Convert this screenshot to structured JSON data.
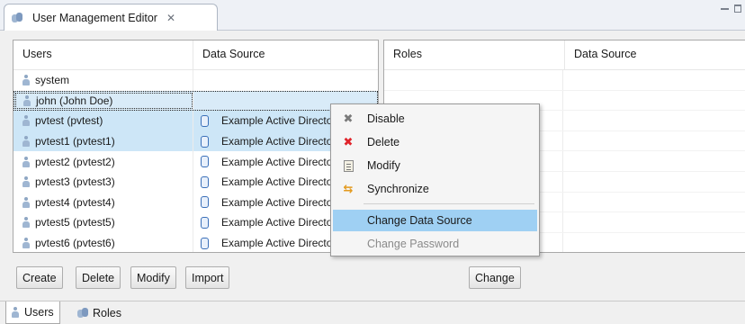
{
  "editor": {
    "tab_title": "User Management Editor",
    "close_glyph": "✕"
  },
  "users_table": {
    "headers": [
      "Users",
      "Data Source"
    ],
    "rows": [
      {
        "name": "system",
        "source": "",
        "selected": false,
        "focused": false
      },
      {
        "name": "john (John Doe)",
        "source": "",
        "selected": false,
        "focused": true
      },
      {
        "name": "pvtest (pvtest)",
        "source": "Example Active Directory",
        "selected": true,
        "focused": false
      },
      {
        "name": "pvtest1 (pvtest1)",
        "source": "Example Active Directory",
        "selected": true,
        "focused": false
      },
      {
        "name": "pvtest2 (pvtest2)",
        "source": "Example Active Directory",
        "selected": false,
        "focused": false
      },
      {
        "name": "pvtest3 (pvtest3)",
        "source": "Example Active Directory",
        "selected": false,
        "focused": false
      },
      {
        "name": "pvtest4 (pvtest4)",
        "source": "Example Active Directory",
        "selected": false,
        "focused": false
      },
      {
        "name": "pvtest5 (pvtest5)",
        "source": "Example Active Directory",
        "selected": false,
        "focused": false
      },
      {
        "name": "pvtest6 (pvtest6)",
        "source": "Example Active Directory",
        "selected": false,
        "focused": false
      }
    ]
  },
  "roles_table": {
    "headers": [
      "Roles",
      "Data Source"
    ]
  },
  "buttons": {
    "create": "Create",
    "delete": "Delete",
    "modify": "Modify",
    "import": "Import",
    "change": "Change"
  },
  "bottom_tabs": {
    "users": "Users",
    "roles": "Roles"
  },
  "context_menu": {
    "disable": "Disable",
    "delete": "Delete",
    "modify": "Modify",
    "synchronize": "Synchronize",
    "change_data_source": "Change Data Source",
    "change_password": "Change Password"
  },
  "colors": {
    "selection": "#cde6f7",
    "menu_highlight": "#9fd0f3",
    "delete_icon": "#e0242b"
  }
}
